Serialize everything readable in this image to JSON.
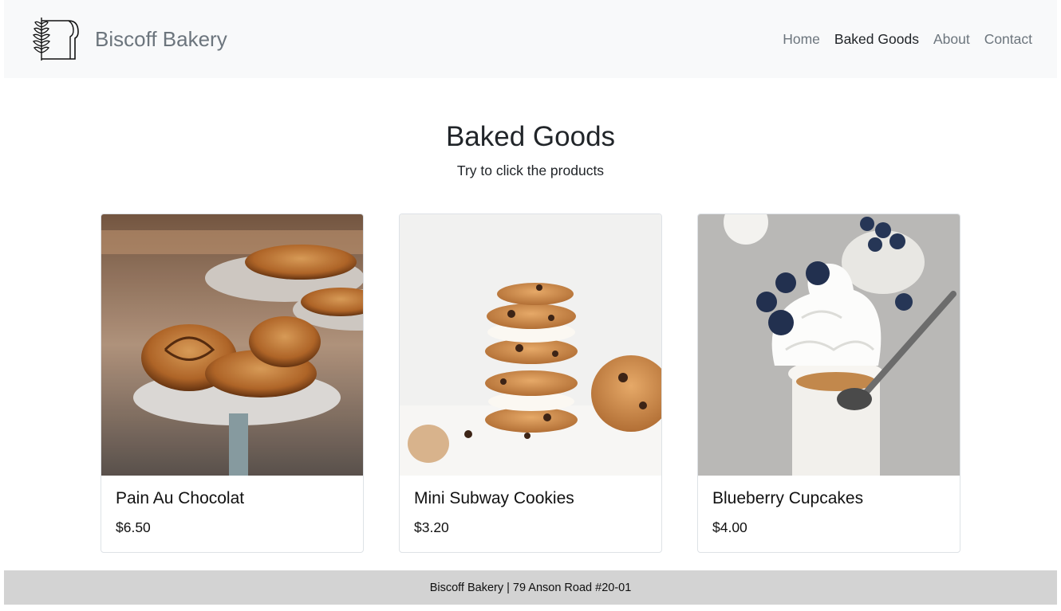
{
  "header": {
    "brand_name": "Biscoff Bakery",
    "nav": [
      {
        "label": "Home"
      },
      {
        "label": "Baked Goods"
      },
      {
        "label": "About"
      },
      {
        "label": "Contact"
      }
    ]
  },
  "main": {
    "title": "Baked Goods",
    "subtitle": "Try to click the products",
    "products": [
      {
        "name": "Pain Au Chocolat",
        "price": "$6.50"
      },
      {
        "name": "Mini Subway Cookies",
        "price": "$3.20"
      },
      {
        "name": "Blueberry Cupcakes",
        "price": "$4.00"
      }
    ]
  },
  "footer": {
    "text": "Biscoff Bakery | 79 Anson Road #20-01"
  },
  "colors": {
    "navbar_bg": "#f8f9fa",
    "footer_bg": "#d3d3d3",
    "muted_text": "#6c757d"
  }
}
